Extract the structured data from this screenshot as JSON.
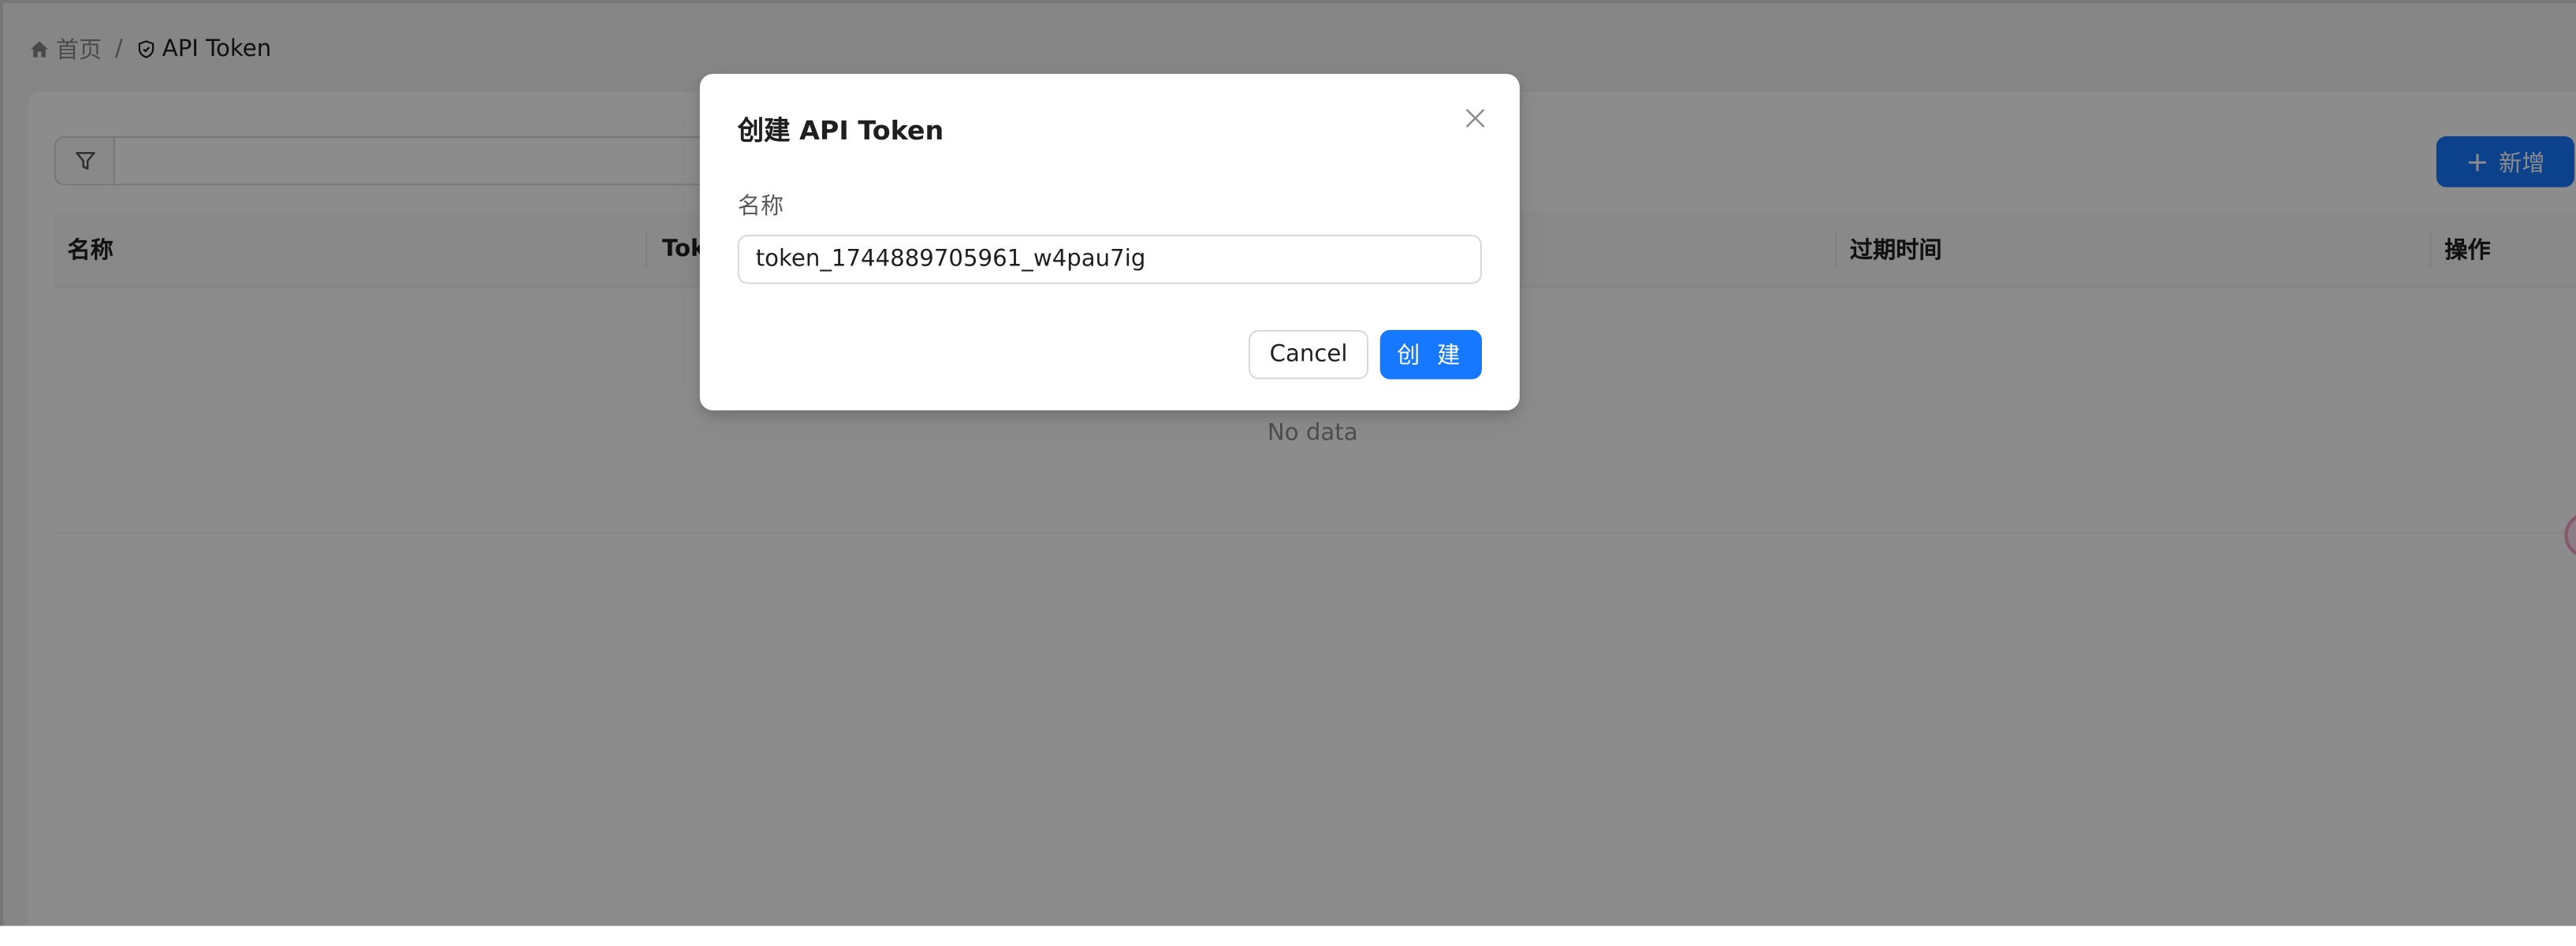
{
  "breadcrumb": {
    "home_label": "首页",
    "separator": "/",
    "current_label": "API Token"
  },
  "toolbar": {
    "add_label": "新增"
  },
  "table": {
    "columns": [
      "名称",
      "Tok",
      "过期时间",
      "操作"
    ],
    "empty_text": "No data"
  },
  "modal": {
    "title": "创建 API Token",
    "name_label": "名称",
    "name_value": "token_1744889705961_w4pau7ig",
    "cancel_label": "Cancel",
    "create_label": "创 建"
  },
  "colors": {
    "primary": "#1677ff",
    "mask": "rgba(0,0,0,0.45)"
  },
  "icons": [
    "home-icon",
    "shield-icon",
    "filter-icon",
    "plus-icon",
    "close-icon"
  ]
}
